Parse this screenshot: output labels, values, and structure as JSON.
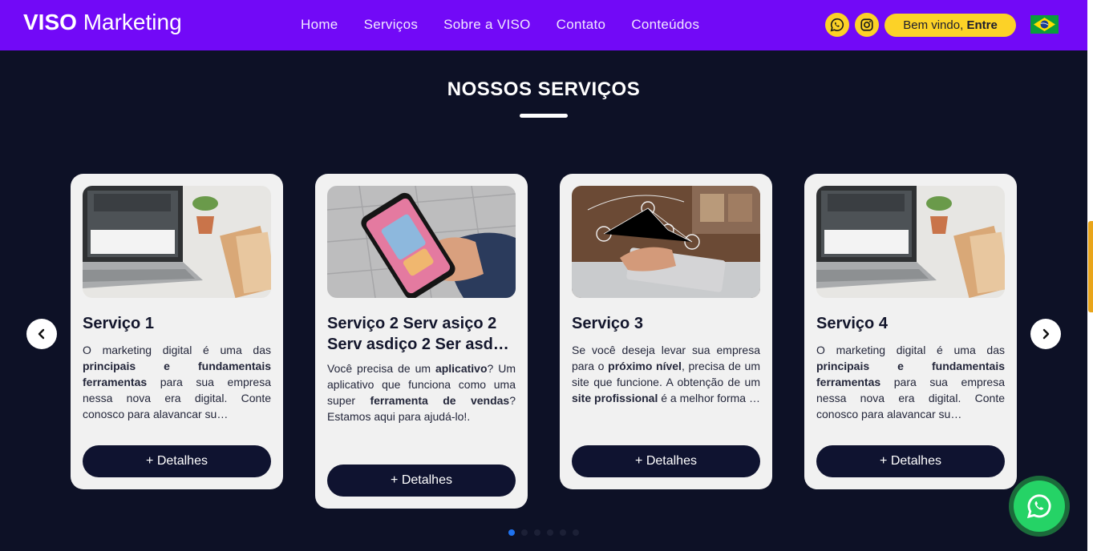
{
  "nav": {
    "brand_bold": "VISO",
    "brand_rest": " Marketing",
    "links": [
      "Home",
      "Serviços",
      "Sobre a VISO",
      "Contato",
      "Conteúdos"
    ],
    "login_prefix": "Bem vindo, ",
    "login_bold": "Entre"
  },
  "icons": {
    "whatsapp": "whatsapp-icon",
    "instagram": "instagram-icon",
    "flag": "brazil-flag-icon",
    "prev": "chevron-left-icon",
    "next": "chevron-right-icon"
  },
  "colors": {
    "navbar": "#7209f7",
    "background": "#0d1126",
    "accent_yellow": "#fcd227",
    "card": "#f1f1f1",
    "button": "#0f1330",
    "whatsapp_green": "#25d366",
    "active_dot": "#1f73f0"
  },
  "section": {
    "title": "NOSSOS SERVIÇOS"
  },
  "cards": [
    {
      "title": "Serviço 1",
      "text_parts": [
        {
          "t": "O marketing digital é uma das "
        },
        {
          "t": "principais e fundamentais ferramentas",
          "b": true
        },
        {
          "t": " para sua empresa nessa nova era digital. Conte conosco para alavancar su…"
        }
      ],
      "button": "+ Detalhes",
      "image": "web-design-laptop-photo"
    },
    {
      "title": "Serviço 2 Serv asiço 2 Serv asdiço 2 Ser asd…",
      "text_parts": [
        {
          "t": "Você precisa de um "
        },
        {
          "t": "aplicativo",
          "b": true
        },
        {
          "t": "? Um aplicativo que funciona como uma super "
        },
        {
          "t": "ferramenta de vendas",
          "b": true
        },
        {
          "t": "? Estamos aqui para ajudá-lo!."
        }
      ],
      "button": "+ Detalhes",
      "image": "smartphone-apps-photo"
    },
    {
      "title": "Serviço 3",
      "text_parts": [
        {
          "t": "Se você deseja levar sua empresa para o "
        },
        {
          "t": "próximo nível",
          "b": true
        },
        {
          "t": ", precisa de um site que funcione. A obtenção de um "
        },
        {
          "t": "site profissional",
          "b": true
        },
        {
          "t": " é a melhor forma …"
        }
      ],
      "button": "+ Detalhes",
      "image": "digital-network-tablet-photo"
    },
    {
      "title": "Serviço 4",
      "text_parts": [
        {
          "t": "O marketing digital é uma das "
        },
        {
          "t": "principais e fundamentais ferramentas",
          "b": true
        },
        {
          "t": " para sua empresa nessa nova era digital. Conte conosco para alavancar su…"
        }
      ],
      "button": "+ Detalhes",
      "image": "web-design-laptop-photo"
    }
  ],
  "carousel": {
    "total_dots": 6,
    "active_index": 0
  }
}
